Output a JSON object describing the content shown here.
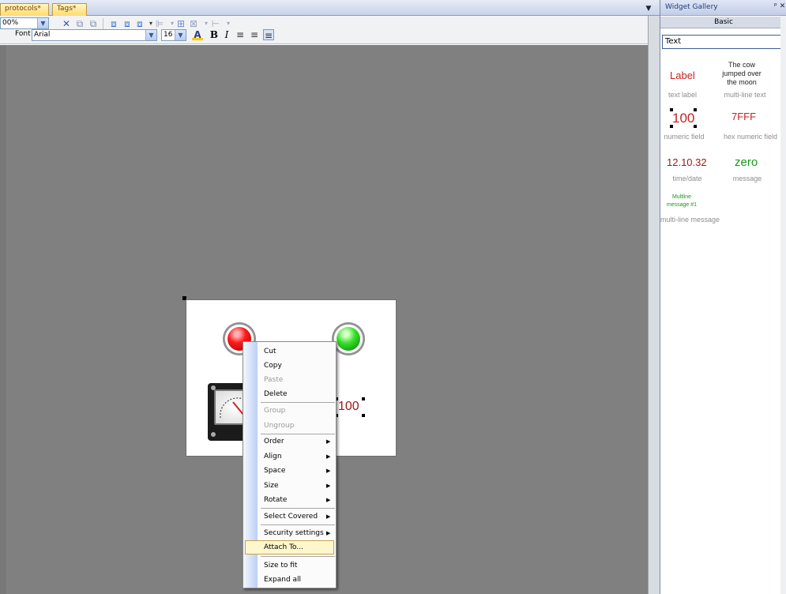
{
  "tabs": [
    {
      "label": "protocols*"
    },
    {
      "label": "Tags*"
    }
  ],
  "toolbar": {
    "zoom_value": "00%",
    "font_label": "Font",
    "font_value": "Arial",
    "font_size": "16"
  },
  "canvas": {
    "numeric_field_value": "100"
  },
  "context_menu": {
    "items": [
      {
        "label": "Cut",
        "enabled": true
      },
      {
        "label": "Copy",
        "enabled": true
      },
      {
        "label": "Paste",
        "enabled": false
      },
      {
        "label": "Delete",
        "enabled": true
      },
      {
        "label": "Group",
        "enabled": false
      },
      {
        "label": "Ungroup",
        "enabled": false
      },
      {
        "label": "Order",
        "enabled": true,
        "submenu": true
      },
      {
        "label": "Align",
        "enabled": true,
        "submenu": true
      },
      {
        "label": "Space",
        "enabled": true,
        "submenu": true
      },
      {
        "label": "Size",
        "enabled": true,
        "submenu": true
      },
      {
        "label": "Rotate",
        "enabled": true,
        "submenu": true
      },
      {
        "label": "Select Covered",
        "enabled": true,
        "submenu": true
      },
      {
        "label": "Security settings",
        "enabled": true,
        "submenu": true
      },
      {
        "label": "Attach To...",
        "enabled": true,
        "highlighted": true
      },
      {
        "label": "Size to fit",
        "enabled": true
      },
      {
        "label": "Expand all",
        "enabled": true
      }
    ]
  },
  "gallery": {
    "title": "Widget Gallery",
    "category_tab": "Basic",
    "selected_type": "Text",
    "widgets": [
      {
        "preview": "Label",
        "caption": "text label"
      },
      {
        "preview": "The cow jumped over the moon",
        "caption": "multi-line text"
      },
      {
        "preview": "100",
        "caption": "numeric field"
      },
      {
        "preview": "7FFF",
        "caption": "hex numeric field"
      },
      {
        "preview": "12.10.32",
        "caption": "time/date"
      },
      {
        "preview": "zero",
        "caption": "message"
      },
      {
        "preview": "Multline message #1",
        "caption": "multi-line message"
      }
    ]
  },
  "colors": {
    "canvas_bg": "#808080",
    "label_red": "#cc1f1f",
    "message_green": "#1a9a1a",
    "menu_highlight": "#fff7cc"
  }
}
